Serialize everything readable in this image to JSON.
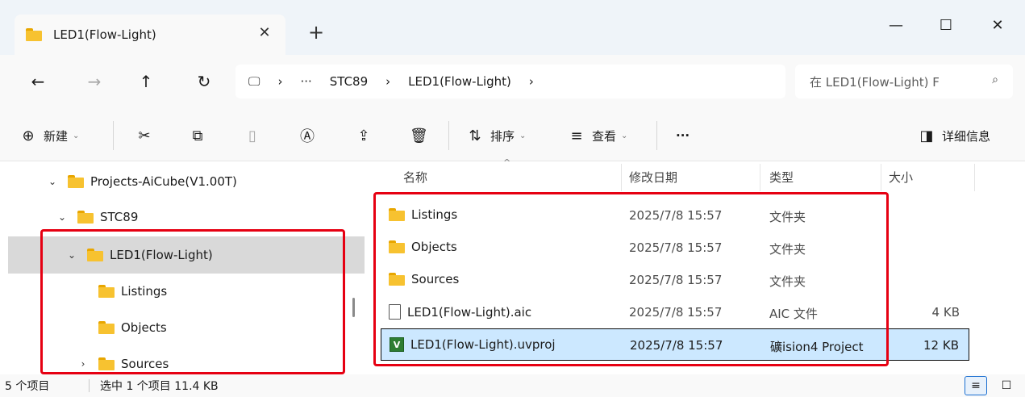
{
  "window": {
    "tab_title": "LED1(Flow-Light)",
    "tab_close": "✕",
    "new_tab": "+",
    "minimize": "—",
    "maximize": "☐",
    "close": "✕"
  },
  "nav": {
    "back": "←",
    "forward": "→",
    "up": "↑",
    "refresh": "↻",
    "pc_icon": "🖵",
    "breadcrumb": [
      "›",
      "···",
      "STC89",
      "›",
      "LED1(Flow-Light)",
      "›"
    ],
    "search_placeholder": "在 LED1(Flow-Light) F",
    "search_icon": "⌕"
  },
  "toolbar": {
    "new_label": "新建",
    "new_icon": "⊕",
    "cut_icon": "✂",
    "copy_icon": "⧉",
    "paste_icon": "▯",
    "rename_icon": "Ⓐ",
    "share_icon": "⇪",
    "delete_icon": "🗑",
    "sort_icon": "⇅",
    "sort_label": "排序",
    "view_icon": "≡",
    "view_label": "查看",
    "more": "···",
    "details_icon": "◨",
    "details_label": "详细信息"
  },
  "tree": {
    "items": [
      {
        "label": "Projects-AiCube(V1.00T)",
        "chevron": "⌄"
      },
      {
        "label": "STC89",
        "chevron": "⌄"
      },
      {
        "label": "LED1(Flow-Light)",
        "chevron": "⌄"
      },
      {
        "label": "Listings",
        "chevron": ""
      },
      {
        "label": "Objects",
        "chevron": ""
      },
      {
        "label": "Sources",
        "chevron": "›"
      }
    ]
  },
  "columns": {
    "name": "名称",
    "date": "修改日期",
    "type": "类型",
    "size": "大小",
    "sort_caret": "^"
  },
  "files": [
    {
      "name": "Listings",
      "date": "2025/7/8 15:57",
      "type": "文件夹",
      "size": "",
      "icon": "folder"
    },
    {
      "name": "Objects",
      "date": "2025/7/8 15:57",
      "type": "文件夹",
      "size": "",
      "icon": "folder"
    },
    {
      "name": "Sources",
      "date": "2025/7/8 15:57",
      "type": "文件夹",
      "size": "",
      "icon": "folder"
    },
    {
      "name": "LED1(Flow-Light).aic",
      "date": "2025/7/8 15:57",
      "type": "AIC 文件",
      "size": "4 KB",
      "icon": "file"
    },
    {
      "name": "LED1(Flow-Light).uvproj",
      "date": "2025/7/8 15:57",
      "type": "礦ision4 Project",
      "size": "12 KB",
      "icon": "uvision"
    }
  ],
  "uv_icon_glyph": "V",
  "status": {
    "count": "5 个项目",
    "selection": "选中 1 个项目  11.4 KB"
  },
  "view_buttons": {
    "details": "≡",
    "tiles": "☐"
  },
  "colors": {
    "highlight_box": "#e60012",
    "selection": "#cce8ff",
    "tree_selection": "#d9d9d9",
    "folder": "#f7c230"
  }
}
